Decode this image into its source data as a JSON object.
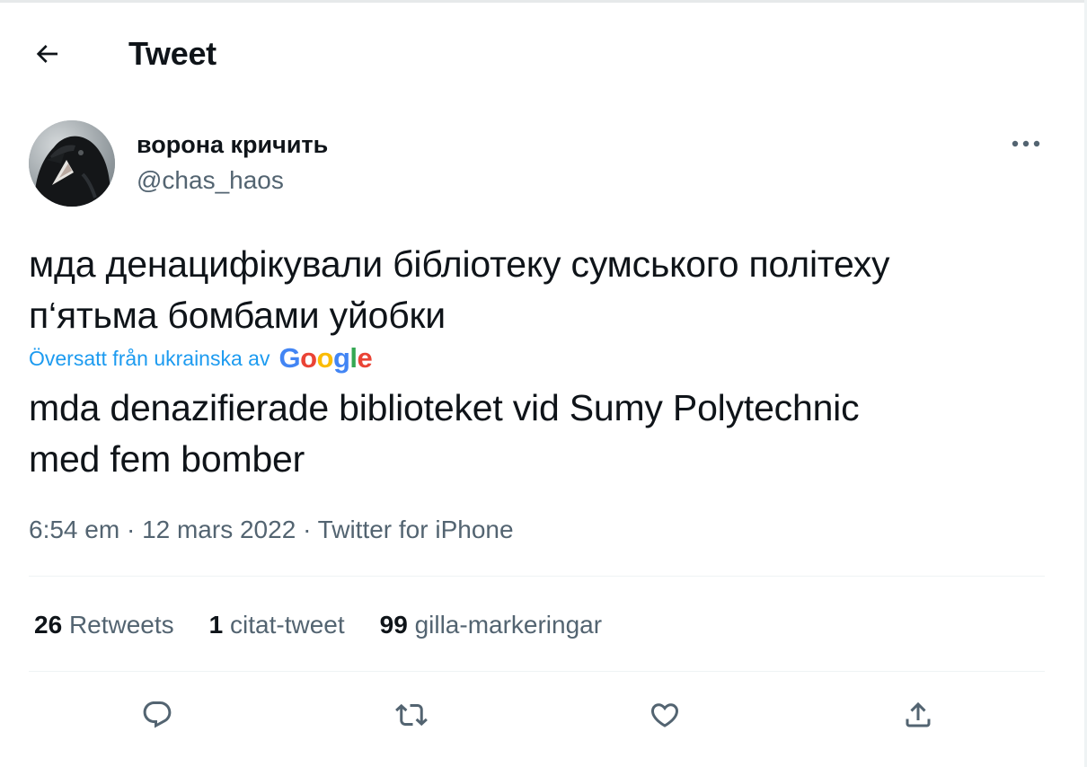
{
  "header": {
    "title": "Tweet"
  },
  "author": {
    "display_name": "ворона кричить",
    "handle": "@chas_haos"
  },
  "tweet": {
    "text_line1": "мда денацифікували бібліотеку сумського політеху",
    "text_line2": "п‘ятьма бомбами уйобки",
    "translated_by": "Översatt från ukrainska av",
    "translation_provider": [
      "G",
      "o",
      "o",
      "g",
      "l",
      "e"
    ],
    "translation_line1": "mda denazifierade biblioteket vid Sumy Polytechnic",
    "translation_line2": "med fem bomber"
  },
  "meta": {
    "time": "6:54 em",
    "separator": "·",
    "date": "12 mars 2022",
    "source": "Twitter for iPhone"
  },
  "stats": {
    "retweets_count": "26",
    "retweets_label": "Retweets",
    "quotes_count": "1",
    "quotes_label": "citat-tweet",
    "likes_count": "99",
    "likes_label": "gilla-markeringar"
  },
  "colors": {
    "text": "#0f1419",
    "secondary": "#536471",
    "accent": "#1d9bf0",
    "divider": "#eff3f4",
    "google": [
      "#4285f4",
      "#ea4335",
      "#fbbc05",
      "#4285f4",
      "#34a853",
      "#ea4335"
    ]
  },
  "icons": {
    "back": "arrow-left-icon",
    "more": "more-horizontal-icon",
    "reply": "reply-icon",
    "retweet": "retweet-icon",
    "like": "heart-icon",
    "share": "share-icon"
  }
}
